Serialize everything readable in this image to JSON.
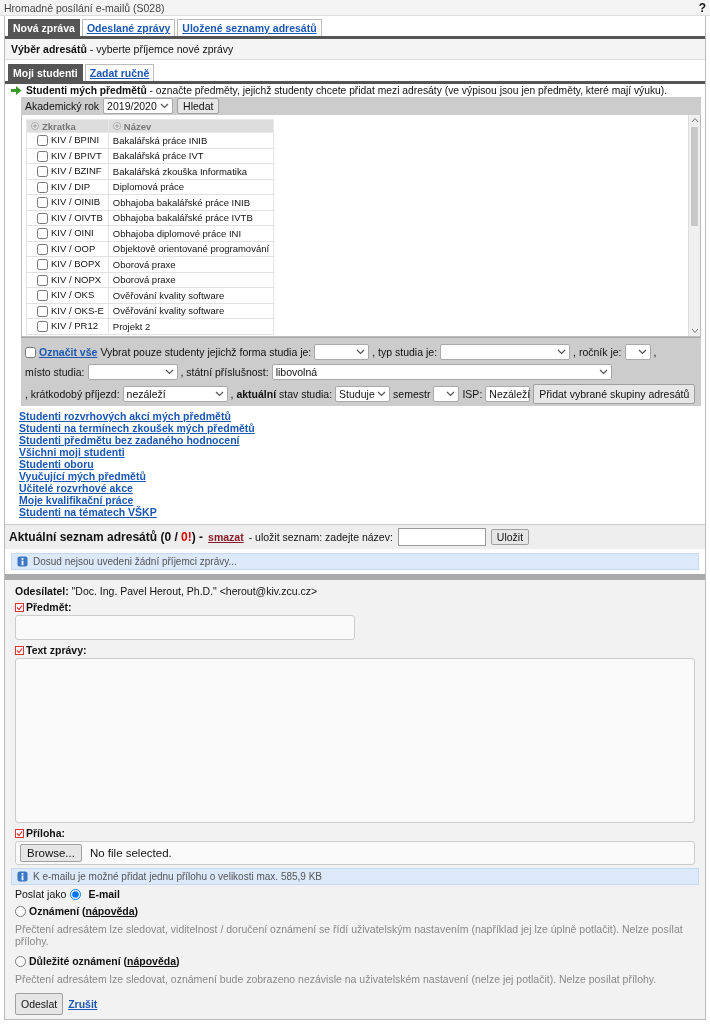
{
  "window": {
    "title": "Hromadné posílání e-mailů (S028)",
    "help": "?"
  },
  "tabs": [
    {
      "label": "Nová zpráva",
      "selected": true
    },
    {
      "label": "Odeslané zprávy",
      "selected": false
    },
    {
      "label": "Uložené seznamy adresátů",
      "selected": false
    }
  ],
  "section_heading": {
    "title": "Výběr adresátů",
    "note": "- vyberte příjemce nové zprávy"
  },
  "subtabs": [
    {
      "label": "Moji studenti",
      "selected": true
    },
    {
      "label": "Zadat ručně",
      "selected": false
    }
  ],
  "instruction": {
    "text": "**Studenti mých předmětů** - označte předměty, jejichž studenty chcete přidat mezi adresáty (ve výpisou jsou jen předměty, které mají výuku)."
  },
  "year_filter": {
    "label": "Akademický rok",
    "value": "2019/2020",
    "button": "Hledat"
  },
  "courses": {
    "columns": [
      "Zkratka",
      "Název"
    ],
    "rows": [
      {
        "code": "KIV / BPINI",
        "name": "Bakalářská práce INIB",
        "checked": false
      },
      {
        "code": "KIV / BPIVT",
        "name": "Bakalářská práce IVT",
        "checked": false
      },
      {
        "code": "KIV / BZINF",
        "name": "Bakalářská zkouška Informatika",
        "checked": false
      },
      {
        "code": "KIV / DIP",
        "name": "Diplomová práce",
        "checked": false
      },
      {
        "code": "KIV / OINIB",
        "name": "Obhajoba bakalářské práce INIB",
        "checked": false
      },
      {
        "code": "KIV / OIVTB",
        "name": "Obhajoba bakalářské práce IVTB",
        "checked": false
      },
      {
        "code": "KIV / OINI",
        "name": "Obhajoba diplomové práce INI",
        "checked": false
      },
      {
        "code": "KIV / OOP",
        "name": "Objektově orientované programování",
        "checked": false
      },
      {
        "code": "KIV / BOPX",
        "name": "Oborová praxe",
        "checked": false
      },
      {
        "code": "KIV / NOPX",
        "name": "Oborová praxe",
        "checked": false
      },
      {
        "code": "KIV / OKS",
        "name": "Ověřování kvality software",
        "checked": false
      },
      {
        "code": "KIV / OKS-E",
        "name": "Ověřování kvality software",
        "checked": false
      },
      {
        "code": "KIV / PR12",
        "name": "Projekt 2",
        "checked": false
      }
    ]
  },
  "group_filter": {
    "select_all": {
      "label": "Označit vše",
      "checked": false
    },
    "items": [
      {
        "kind": "text",
        "text": "Vybrat pouze studenty jejichž forma studia je:"
      },
      {
        "kind": "select"
      },
      {
        "kind": "text",
        "text": ", typ studia je:"
      },
      {
        "kind": "select"
      },
      {
        "kind": "text",
        "text": ", ročník je:"
      },
      {
        "kind": "select"
      },
      {
        "kind": "text",
        "text": ","
      },
      {
        "kind": "break"
      },
      {
        "kind": "text",
        "text": "místo studia:"
      },
      {
        "kind": "select"
      },
      {
        "kind": "text",
        "text": ", státní příslušnost:"
      },
      {
        "kind": "select",
        "value": "libovolná"
      },
      {
        "kind": "break"
      },
      {
        "kind": "text",
        "text": ", krátkodobý příjezd:"
      },
      {
        "kind": "select",
        "value": "nezáleží"
      },
      {
        "kind": "text",
        "text": ", **aktuální** stav studia:"
      },
      {
        "kind": "select",
        "value": "Studuje"
      },
      {
        "kind": "text",
        "text": "semestr"
      },
      {
        "kind": "select"
      },
      {
        "kind": "text",
        "text": "ISP:"
      },
      {
        "kind": "select",
        "value": "Nezáleží"
      },
      {
        "kind": "button",
        "text": "Přidat vybrané skupiny adresátů"
      }
    ]
  },
  "group_links": [
    "Studenti rozvrhových akcí mých předmětů",
    "Studenti na termínech zkoušek mých předmětů",
    "Studenti předmětu bez zadaného hodnocení",
    "Všichni moji studenti",
    "Studenti oboru",
    "Vyučující mých předmětů",
    "Učitelé rozvrhové akce",
    "Moje kvalifikační práce",
    "Studenti na tématech VŠKP"
  ],
  "recipient_list": {
    "title": "Aktuální seznam adresátů (0 / ",
    "warning": "0!",
    "title_end": ") -",
    "delete_link": "smazat",
    "save_label": "- uložit seznam: zadejte název:",
    "save_button": "Uložit",
    "info": "Dosud nejsou uvedeni žádní příjemci zprávy..."
  },
  "compose": {
    "sender": {
      "label": "Odesílatel:",
      "value": "\"Doc. Ing. Pavel Herout, Ph.D.\" <herout@kiv.zcu.cz>"
    },
    "subject": {
      "label": "Předmět:",
      "required": true
    },
    "body": {
      "label": "Text zprávy:",
      "required": true
    },
    "attachment": {
      "label": "Příloha:",
      "required": true,
      "button": "Browse...",
      "status": "No file selected.",
      "info": "K e-mailu je možné přidat jednu přílohu o velikosti max. 585,9 KB"
    },
    "send_as": {
      "label": "Poslat jako",
      "options": [
        {
          "label": "E-mail",
          "selected": true
        },
        {
          "label": "Oznámení (",
          "help_link": "nápověda",
          "label_end": ")",
          "description": "Přečtení adresátem lze sledovat, viditelnost / doručení oznámení se řídí uživatelským nastavením (například jej lze úplně potlačit). Nelze posílat přílohy.",
          "selected": false
        },
        {
          "label": "Důležité oznámení (",
          "help_link": "nápověda",
          "label_end": ")",
          "description": "Přečtení adresátem lze sledovat, oznámení bude zobrazeno nezávisle na uživatelském nastavení (nelze jej potlačit). Nelze posílat přílohy.",
          "selected": false
        }
      ]
    },
    "send_button": "Odeslat",
    "cancel_link": "Zrušit"
  }
}
